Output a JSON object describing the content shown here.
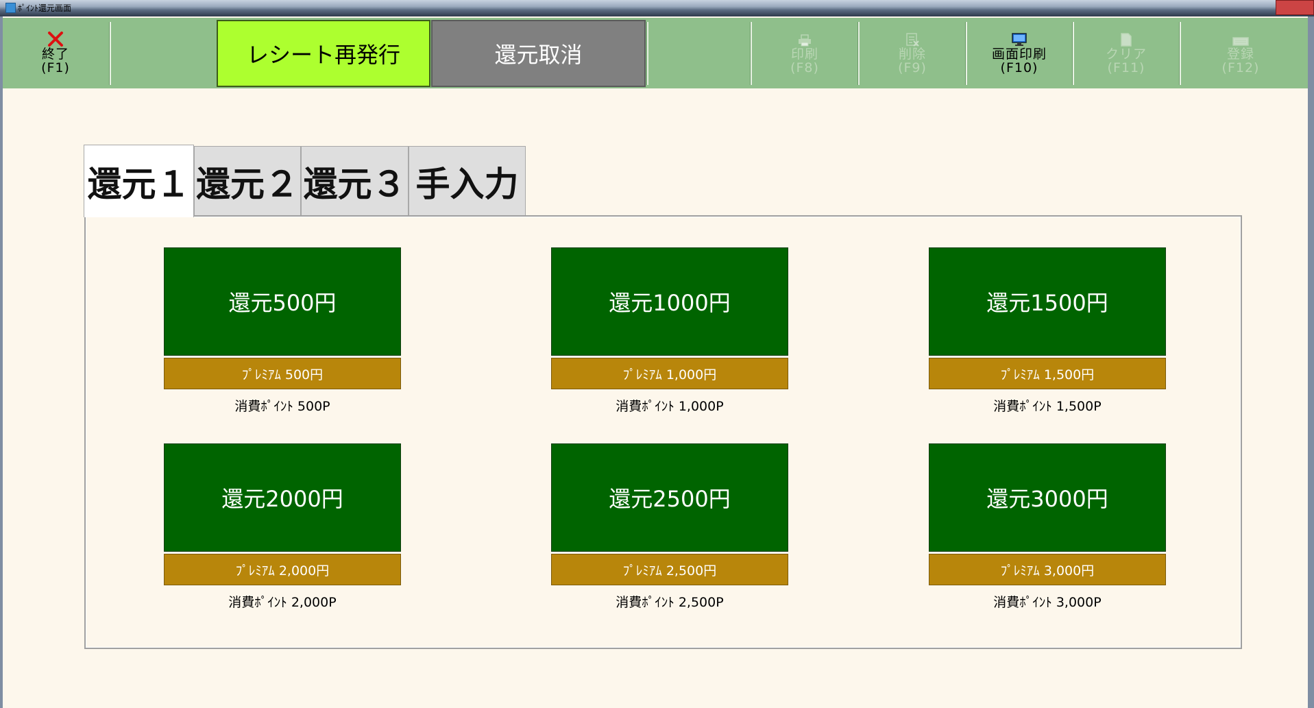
{
  "window": {
    "title": "ﾎﾟｲﾝﾄ還元画面"
  },
  "toolbar": {
    "exit": {
      "label": "終了",
      "key": "(F1)",
      "icon": "close-x-icon"
    },
    "reissue_label": "レシート再発行",
    "cancel_label": "還元取消",
    "print": {
      "label": "印刷",
      "key": "(F8)",
      "icon": "printer-icon"
    },
    "delete": {
      "label": "削除",
      "key": "(F9)",
      "icon": "delete-document-icon"
    },
    "screen_print": {
      "label": "画面印刷",
      "key": "(F10)",
      "icon": "monitor-icon"
    },
    "clear": {
      "label": "クリア",
      "key": "(F11)",
      "icon": "eraser-document-icon"
    },
    "register": {
      "label": "登録",
      "key": "(F12)",
      "icon": "keyboard-icon"
    },
    "colors": {
      "bar": "#8fbf8b",
      "reissue_bg": "#adff2f",
      "cancel_bg": "#808080",
      "disabled_text": "#b9d6b4"
    }
  },
  "tabs": [
    {
      "label": "還元１",
      "active": true
    },
    {
      "label": "還元２",
      "active": false
    },
    {
      "label": "還元３",
      "active": false
    },
    {
      "label": "手入力",
      "active": false
    }
  ],
  "cards": [
    {
      "title": "還元500円",
      "premium": "ﾌﾟﾚﾐｱﾑ 500円",
      "points": "消費ﾎﾟｲﾝﾄ 500P"
    },
    {
      "title": "還元1000円",
      "premium": "ﾌﾟﾚﾐｱﾑ 1,000円",
      "points": "消費ﾎﾟｲﾝﾄ 1,000P"
    },
    {
      "title": "還元1500円",
      "premium": "ﾌﾟﾚﾐｱﾑ 1,500円",
      "points": "消費ﾎﾟｲﾝﾄ 1,500P"
    },
    {
      "title": "還元2000円",
      "premium": "ﾌﾟﾚﾐｱﾑ 2,000円",
      "points": "消費ﾎﾟｲﾝﾄ 2,000P"
    },
    {
      "title": "還元2500円",
      "premium": "ﾌﾟﾚﾐｱﾑ 2,500円",
      "points": "消費ﾎﾟｲﾝﾄ 2,500P"
    },
    {
      "title": "還元3000円",
      "premium": "ﾌﾟﾚﾐｱﾑ 3,000円",
      "points": "消費ﾎﾟｲﾝﾄ 3,000P"
    }
  ],
  "colors": {
    "card_main": "#006400",
    "card_premium": "#b8860b",
    "background": "#fdf7ec"
  }
}
